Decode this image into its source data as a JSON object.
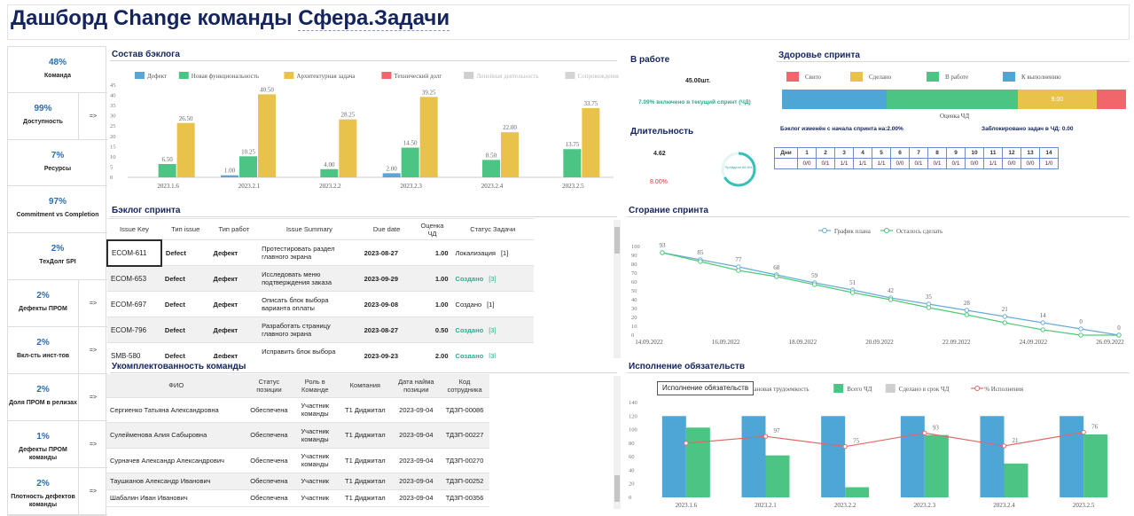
{
  "title": {
    "prefix": "Дашборд Change команды ",
    "team": "Сфера.Задачи"
  },
  "kpis": [
    {
      "value": "48%",
      "label": "Команда",
      "arrow": ""
    },
    {
      "value": "99%",
      "label": "Доступность",
      "arrow": "=>"
    },
    {
      "value": "7%",
      "label": "Ресурсы",
      "arrow": ""
    },
    {
      "value": "97%",
      "label": "Commitment vs Completion",
      "arrow": ""
    },
    {
      "value": "2%",
      "label": "ТехДолг SPI",
      "arrow": ""
    },
    {
      "value": "2%",
      "label": "Дефекты ПРОМ",
      "arrow": "=>"
    },
    {
      "value": "2%",
      "label": "Вкл-сть инст-тов",
      "arrow": "=>"
    },
    {
      "value": "2%",
      "label": "Доля ПРОМ в релизах",
      "arrow": "=>"
    },
    {
      "value": "1%",
      "label": "Дефекты ПРОМ команды",
      "arrow": "=>"
    },
    {
      "value": "2%",
      "label": "Плотность дефектов команды",
      "arrow": "=>"
    }
  ],
  "backlog": {
    "title": "Состав бэклога"
  },
  "chart_data": [
    {
      "type": "bar",
      "title": "Состав бэклога",
      "categories": [
        "2023.1.6",
        "2023.2.1",
        "2023.2.2",
        "2023.2.3",
        "2023.2.4",
        "2023.2.5"
      ],
      "legend": [
        "Дефект",
        "Новая функциональность",
        "Архитектурная задача",
        "Технический долг",
        "Линейная деятельность",
        "Сопровождение"
      ],
      "colors": [
        "#5aa6d6",
        "#4cc584",
        "#e8c24a",
        "#f0666a",
        "#cfcfcf",
        "#d4d4d4"
      ],
      "series": [
        {
          "name": "Дефект",
          "values": [
            0,
            1.0,
            0,
            2.0,
            0,
            0
          ]
        },
        {
          "name": "Новая функциональность",
          "values": [
            6.5,
            10.25,
            4.0,
            14.5,
            8.5,
            13.75
          ]
        },
        {
          "name": "Архитектурная задача",
          "values": [
            26.5,
            40.5,
            28.25,
            39.25,
            22.0,
            33.75
          ]
        }
      ],
      "yticks": [
        0,
        5,
        10,
        15,
        20,
        25,
        30,
        35,
        40,
        45
      ],
      "ylim": [
        0,
        45
      ]
    },
    {
      "type": "line",
      "title": "Сгорание спринта",
      "x": [
        "14.09.2022",
        "16.09.2022",
        "18.09.2022",
        "20.09.2022",
        "22.09.2022",
        "24.09.2022",
        "26.09.2022"
      ],
      "series": [
        {
          "name": "График плана",
          "color": "#6aaad6",
          "values": [
            93,
            85,
            77,
            68,
            59,
            51,
            42,
            35,
            28,
            21,
            14,
            7,
            0
          ],
          "labels": [
            "93",
            "85",
            "77",
            "68",
            "59",
            "51",
            "42",
            "35",
            "28",
            "21",
            "14",
            "0",
            "0"
          ]
        },
        {
          "name": "Осталось сделать",
          "color": "#4fc97a",
          "values": [
            93,
            83,
            73,
            66,
            57,
            48,
            40,
            31,
            23,
            14,
            6,
            0,
            0
          ]
        }
      ],
      "yticks": [
        0,
        10,
        20,
        30,
        40,
        50,
        60,
        70,
        80,
        90,
        100
      ],
      "ylim": [
        0,
        100
      ]
    },
    {
      "type": "bar",
      "title": "Исполнение обязательств",
      "categories": [
        "2023.1.6",
        "2023.2.1",
        "2023.2.2",
        "2023.2.3",
        "2023.2.4",
        "2023.2.5"
      ],
      "legend": [
        "Плановая трудоемкость",
        "Всего ЧД",
        "Сделано в срок ЧД",
        "% Исполнения"
      ],
      "colors": [
        "#4da6d6",
        "#4cc584",
        "#cfcfcf",
        "#e06868"
      ],
      "series": [
        {
          "name": "Плановая трудоемкость",
          "values": [
            120,
            120,
            120,
            120,
            120,
            120
          ]
        },
        {
          "name": "Всего ЧД",
          "values": [
            103,
            62,
            15,
            92,
            50,
            93
          ]
        },
        {
          "name": "% Исполнения",
          "values": [
            80,
            90,
            75,
            95,
            76,
            96
          ],
          "labels": [
            "",
            "97",
            "75",
            "93",
            "21",
            "76"
          ]
        }
      ],
      "yticks": [
        0,
        20,
        40,
        60,
        80,
        100,
        120,
        140
      ],
      "ylim": [
        0,
        140
      ]
    }
  ],
  "in_work": {
    "title": "В работе",
    "count": "45.00шт.",
    "included": "7.09% включено в текущий спринт (ЧД)"
  },
  "duration": {
    "title": "Длительность",
    "value": "4.62",
    "percent": "8.00%",
    "circle_label": "Пройдено 66.6%",
    "progress": 0.666
  },
  "health": {
    "title": "Здоровье спринта",
    "legend": [
      {
        "label": "Свито",
        "color": "#f0666a"
      },
      {
        "label": "Сделано",
        "color": "#e8c24a"
      },
      {
        "label": "В работе",
        "color": "#4cc584"
      },
      {
        "label": "К выполнению",
        "color": "#4da6d6"
      }
    ],
    "bar": [
      {
        "label": "",
        "value": 50,
        "color": "#4da6d6"
      },
      {
        "label": "",
        "value": 63,
        "color": "#4cc584"
      },
      {
        "label": "9.00",
        "value": 38,
        "color": "#e8c24a"
      },
      {
        "label": "",
        "value": 14,
        "color": "#f0666a"
      }
    ],
    "caption": "Оценка ЧД",
    "changed": "Бэклог изменён с начала спринта на:2.00%",
    "blocked": "Заблокировано задач в ЧД: 0.00",
    "grid_header": [
      "Дни",
      "1",
      "2",
      "3",
      "4",
      "5",
      "6",
      "7",
      "8",
      "9",
      "10",
      "11",
      "12",
      "13",
      "14"
    ],
    "grid_values": [
      "",
      "0/0",
      "0/1",
      "1/1",
      "1/1",
      "1/1",
      "0/0",
      "0/1",
      "0/1",
      "0/1",
      "0/0",
      "1/1",
      "0/0",
      "0/0",
      "1/0"
    ]
  },
  "sprint_backlog": {
    "title": "Бэклог спринта",
    "headers": [
      "Issue Key",
      "Тип issue",
      "Тип работ",
      "Issue Summary",
      "Due date",
      "Оценка ЧД",
      "Статус Задачи"
    ],
    "rows": [
      {
        "key": "ECOM-611",
        "type": "Defect",
        "work": "Дефект",
        "summary": "Протестировать раздел главного экрана",
        "due": "2023-08-27",
        "est": "1.00",
        "status": "Локализация",
        "count": "[1]",
        "green": false
      },
      {
        "key": "ECOM-653",
        "type": "Defect",
        "work": "Дефект",
        "summary": "Исследовать меню подтверждения заказа",
        "due": "2023-09-29",
        "est": "1.00",
        "status": "Создано",
        "count": "[3]",
        "green": true
      },
      {
        "key": "ECOM-697",
        "type": "Defect",
        "work": "Дефект",
        "summary": "Описать блок выбора варианта оплаты",
        "due": "2023-09-08",
        "est": "1.00",
        "status": "Создано",
        "count": "[1]",
        "green": false
      },
      {
        "key": "ECOM-796",
        "type": "Defect",
        "work": "Дефект",
        "summary": "Разработать страницу главного экрана",
        "due": "2023-08-27",
        "est": "0.50",
        "status": "Создано",
        "count": "[3]",
        "green": true
      },
      {
        "key": "SMB-580",
        "type": "Defect",
        "work": "Дефект",
        "summary": "Исправить блок выбора адреса пункта выдачи",
        "due": "2023-09-23",
        "est": "2.00",
        "status": "Создано",
        "count": "[3]",
        "green": true
      }
    ]
  },
  "staffing": {
    "title": "Укомплектованность команды",
    "headers": [
      "ФИО",
      "Статус позиции",
      "Роль в Команде",
      "Компания",
      "Дата найма позиции",
      "Код сотрудника"
    ],
    "rows": [
      {
        "name": "Сергиенко Татьяна Александровна",
        "status": "Обеспечена",
        "role": "Участник команды",
        "company": "Т1 Диджитал",
        "date": "2023-09-04",
        "code": "ТДЗП-00086"
      },
      {
        "name": "Сулейменова Алия Сабыровна",
        "status": "Обеспечена",
        "role": "Участник команды",
        "company": "Т1 Диджитал",
        "date": "2023-09-04",
        "code": "ТДЗП-00227"
      },
      {
        "name": "Сурначев Александр Александрович",
        "status": "Обеспечена",
        "role": "Участник команды",
        "company": "Т1 Диджитал",
        "date": "2023-09-04",
        "code": "ТДЗП-00270"
      },
      {
        "name": "Таушканов Александр Иванович",
        "status": "Обеспечена",
        "role": "Участник",
        "company": "Т1 Диджитал",
        "date": "2023-09-04",
        "code": "ТДЗП-00252"
      },
      {
        "name": "Шабалин Иван Иванович",
        "status": "Обеспечена",
        "role": "Участник",
        "company": "Т1 Диджитал",
        "date": "2023-09-04",
        "code": "ТДЗП-00356"
      }
    ]
  },
  "burndown": {
    "title": "Сгорание спринта"
  },
  "commitment": {
    "title": "Исполнение обязательств",
    "tooltip": "Исполнение обязательств"
  }
}
